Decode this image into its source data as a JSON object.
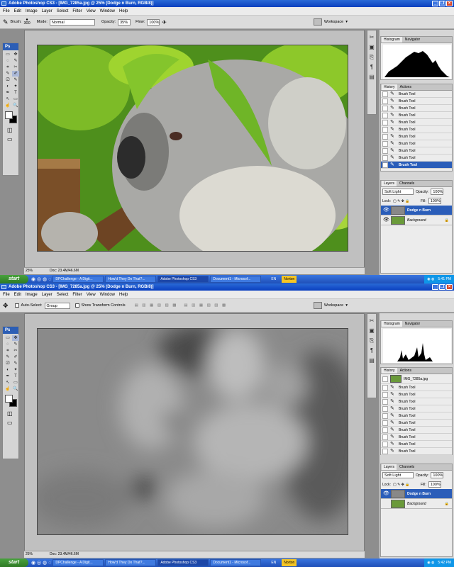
{
  "shot1": {
    "title": "Adobe Photoshop CS3 - [IMG_7285a.jpg @ 25% (Dodge n Burn, RGB/8)]",
    "menu": [
      "File",
      "Edit",
      "Image",
      "Layer",
      "Select",
      "Filter",
      "View",
      "Window",
      "Help"
    ],
    "options": {
      "brush_label": "Brush:",
      "brush_size": "300",
      "mode_label": "Mode:",
      "mode_value": "Normal",
      "opacity_label": "Opacity:",
      "opacity_value": "35%",
      "flow_label": "Flow:",
      "flow_value": "100%",
      "workspace": "Workspace"
    },
    "status": {
      "zoom": "25%",
      "doc": "Doc: 23.4M/46.6M"
    },
    "history_tabs": [
      "History",
      "Actions"
    ],
    "history_items": [
      "Brush Tool",
      "Brush Tool",
      "Brush Tool",
      "Brush Tool",
      "Brush Tool",
      "Brush Tool",
      "Brush Tool",
      "Brush Tool",
      "Brush Tool",
      "Brush Tool",
      "Brush Tool"
    ],
    "layers": {
      "tabs": [
        "Layers",
        "Channels"
      ],
      "blend": "Soft Light",
      "opacity_label": "Opacity:",
      "opacity": "100%",
      "lock_label": "Lock:",
      "fill_label": "Fill:",
      "fill": "100%",
      "items": [
        "Dodge n Burn",
        "Background"
      ]
    },
    "nav_tabs": [
      "Histogram",
      "Navigator"
    ],
    "taskbar": {
      "start": "start",
      "buttons": [
        "DPChallenge - A Digit...",
        "How'd They Do That?...",
        "Adobe Photoshop CS3",
        "Document1 - Microsof..."
      ],
      "lang": "EN",
      "norton": "Norton",
      "time": "5:41 PM"
    }
  },
  "shot2": {
    "title": "Adobe Photoshop CS3 - [IMG_7285a.jpg @ 25% (Dodge n Burn, RGB/8)]",
    "menu": [
      "File",
      "Edit",
      "Image",
      "Layer",
      "Select",
      "Filter",
      "View",
      "Window",
      "Help"
    ],
    "options": {
      "auto_select": "Auto-Select:",
      "group": "Group",
      "show_transform": "Show Transform Controls",
      "workspace": "Workspace"
    },
    "status": {
      "zoom": "25%",
      "doc": "Doc: 23.4M/46.6M"
    },
    "history_tabs": [
      "History",
      "Actions"
    ],
    "history_snapshot": "IMG_7285a.jpg",
    "history_items": [
      "Brush Tool",
      "Brush Tool",
      "Brush Tool",
      "Brush Tool",
      "Brush Tool",
      "Brush Tool",
      "Brush Tool",
      "Brush Tool",
      "Brush Tool",
      "Brush Tool"
    ],
    "layers": {
      "tabs": [
        "Layers",
        "Channels"
      ],
      "blend": "Soft Light",
      "opacity_label": "Opacity:",
      "opacity": "100%",
      "lock_label": "Lock:",
      "fill_label": "Fill:",
      "fill": "100%",
      "items": [
        "Dodge n Burn",
        "Background"
      ]
    },
    "nav_tabs": [
      "Histogram",
      "Navigator"
    ],
    "taskbar": {
      "start": "start",
      "buttons": [
        "DPChallenge - A Digit...",
        "How'd They Do That?...",
        "Adobe Photoshop CS3",
        "Document1 - Microsof..."
      ],
      "lang": "EN",
      "norton": "Norton",
      "time": "5:42 PM"
    }
  },
  "colors": {
    "xp_blue": "#0a3fbf",
    "selection": "#2a5db9",
    "panel": "#ececec",
    "start_green": "#3b8f30"
  },
  "icons": {
    "tool_glyphs": [
      "▭",
      "✥",
      "◌",
      "✎",
      "⌗",
      "✂",
      "✎",
      "✐",
      "⎚",
      "✎",
      "◐",
      "✦",
      "✒",
      "T",
      "↖",
      "▭",
      "☝",
      "🔍"
    ]
  }
}
